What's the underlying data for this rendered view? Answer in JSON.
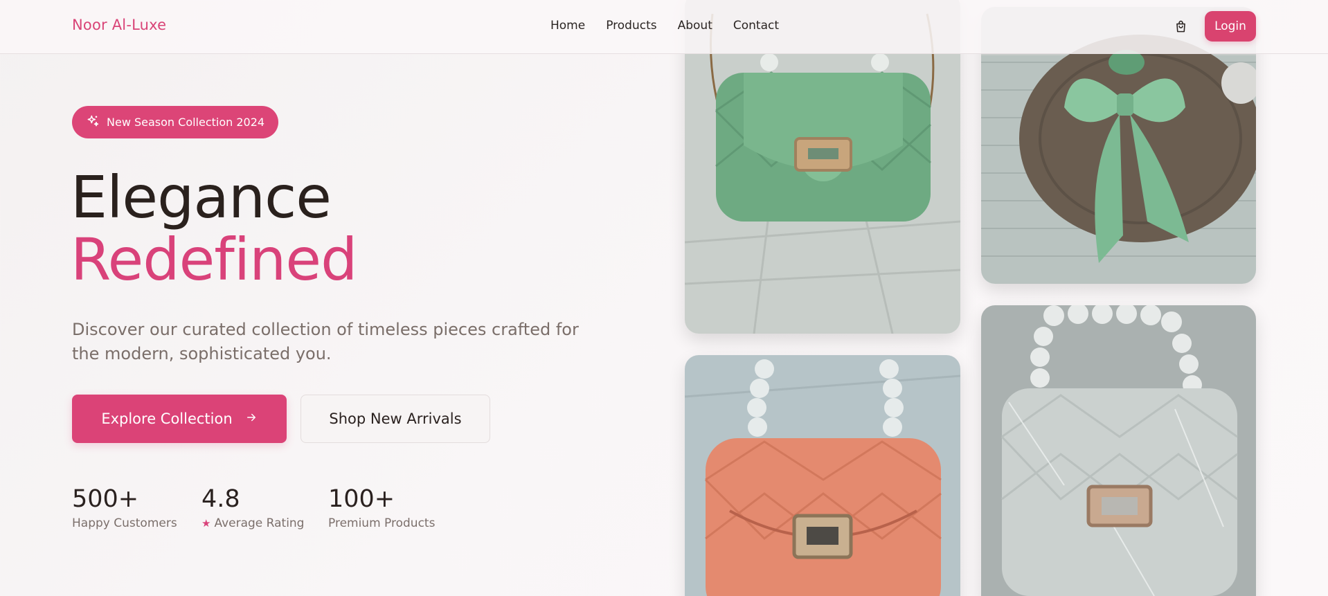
{
  "header": {
    "brand": "Noor Al-Luxe",
    "nav": [
      "Home",
      "Products",
      "About",
      "Contact"
    ],
    "cart_icon": "shopping-bag-icon",
    "login_label": "Login"
  },
  "hero": {
    "badge": "New Season Collection 2024",
    "badge_icon": "sparkles-icon",
    "headline_line1": "Elegance",
    "headline_line2": "Redefined",
    "subtext": "Discover our curated collection of timeless pieces crafted for the modern, sophisticated you.",
    "primary_button": "Explore Collection",
    "primary_icon": "arrow-right-icon",
    "secondary_button": "Shop New Arrivals"
  },
  "stats": [
    {
      "value": "500+",
      "label": "Happy Customers"
    },
    {
      "value": "4.8",
      "label": "Average Rating",
      "icon": "star-icon"
    },
    {
      "value": "100+",
      "label": "Premium Products"
    }
  ],
  "colors": {
    "accent": "#d9436f",
    "text": "#2a211f",
    "muted": "#7a6e69"
  }
}
